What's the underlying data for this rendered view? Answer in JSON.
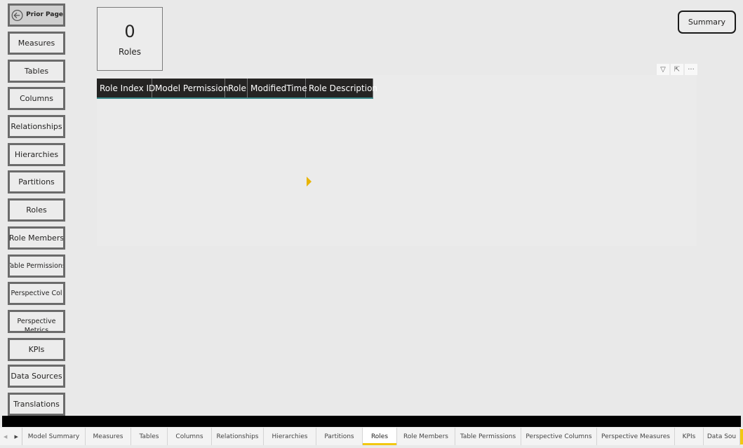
{
  "nav": {
    "prior_page": "Prior Page",
    "buttons": [
      "Measures",
      "Tables",
      "Columns",
      "Relationships",
      "Hierarchies",
      "Partitions",
      "Roles",
      "Role Members",
      "Table Permissions",
      "Perspective Col",
      "Perspective Metrics",
      "KPIs",
      "Data Sources",
      "Translations"
    ]
  },
  "card": {
    "value": "0",
    "label": "Roles"
  },
  "summary_button": "Summary",
  "table": {
    "columns": [
      "Role Index ID",
      "Model Permission",
      "Role",
      "ModifiedTime",
      "Role Description"
    ],
    "rows": []
  },
  "visual_icons": [
    "filter-icon",
    "focus-mode-icon",
    "more-options-icon"
  ],
  "tabs": {
    "items": [
      "Model Summary",
      "Measures",
      "Tables",
      "Columns",
      "Relationships",
      "Hierarchies",
      "Partitions",
      "Roles",
      "Role Members",
      "Table Permissions",
      "Perspective Columns",
      "Perspective Measures",
      "KPIs",
      "Data Sou"
    ],
    "active": "Roles"
  },
  "colors": {
    "accent": "#f2c811",
    "header_bg": "#252423"
  }
}
